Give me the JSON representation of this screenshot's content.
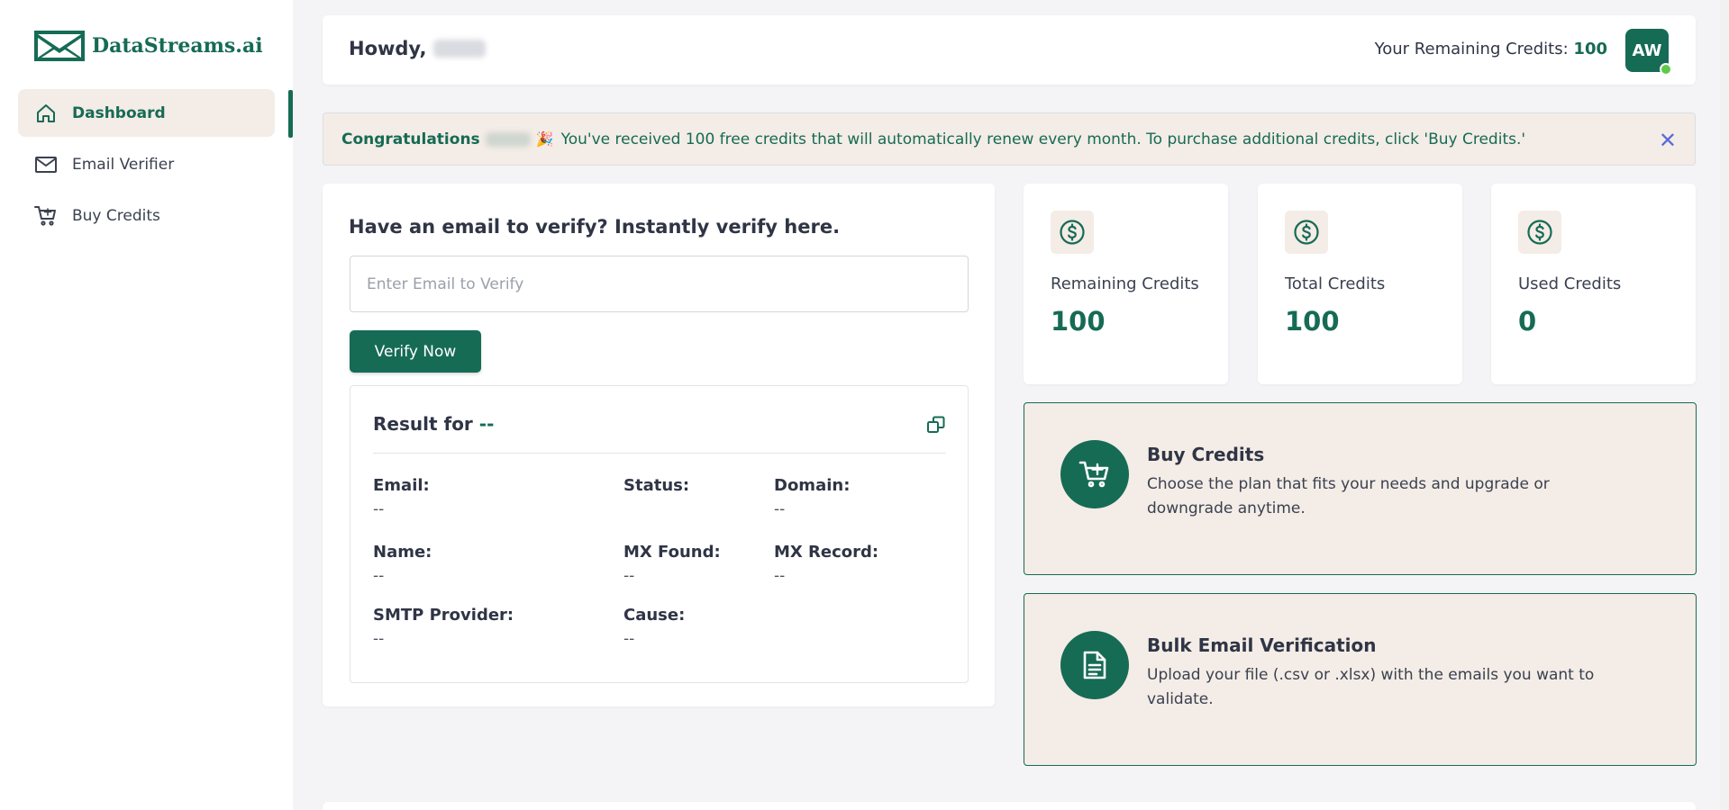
{
  "brand": {
    "name": "DataStreams.ai",
    "color": "#166b55"
  },
  "sidebar": {
    "items": [
      {
        "label": "Dashboard",
        "icon": "home-icon",
        "active": true
      },
      {
        "label": "Email Verifier",
        "icon": "mail-icon",
        "active": false
      },
      {
        "label": "Buy Credits",
        "icon": "cart-icon",
        "active": false
      }
    ]
  },
  "header": {
    "greeting": "Howdy,",
    "credits_label": "Your Remaining Credits:",
    "credits_value": "100",
    "avatar_initials": "AW"
  },
  "banner": {
    "congrats": "Congratulations",
    "emoji": "🎉",
    "message": "You've received 100 free credits that will automatically renew every month. To purchase additional credits, click 'Buy Credits.'",
    "close": "✕"
  },
  "verify": {
    "title": "Have an email to verify? Instantly verify here.",
    "placeholder": "Enter Email to Verify",
    "value": "",
    "button": "Verify Now",
    "result": {
      "title": "Result for",
      "target": "--",
      "fields": [
        {
          "label": "Email:",
          "value": "--"
        },
        {
          "label": "Status:",
          "value": ""
        },
        {
          "label": "Domain:",
          "value": "--"
        },
        {
          "label": "Name:",
          "value": "--"
        },
        {
          "label": "MX Found:",
          "value": "--"
        },
        {
          "label": "MX Record:",
          "value": "--"
        },
        {
          "label": "SMTP Provider:",
          "value": "--"
        },
        {
          "label": "Cause:",
          "value": "--"
        }
      ]
    }
  },
  "stats": [
    {
      "label": "Remaining Credits",
      "value": "100",
      "icon": "dollar-icon"
    },
    {
      "label": "Total Credits",
      "value": "100",
      "icon": "dollar-icon"
    },
    {
      "label": "Used Credits",
      "value": "0",
      "icon": "dollar-icon"
    }
  ],
  "actions": [
    {
      "title": "Buy Credits",
      "desc": "Choose the plan that fits your needs and upgrade or downgrade anytime.",
      "icon": "cart-plus-icon"
    },
    {
      "title": "Bulk Email Verification",
      "desc": "Upload your file (.csv or .xlsx) with the emails you want to validate.",
      "icon": "document-icon"
    }
  ]
}
